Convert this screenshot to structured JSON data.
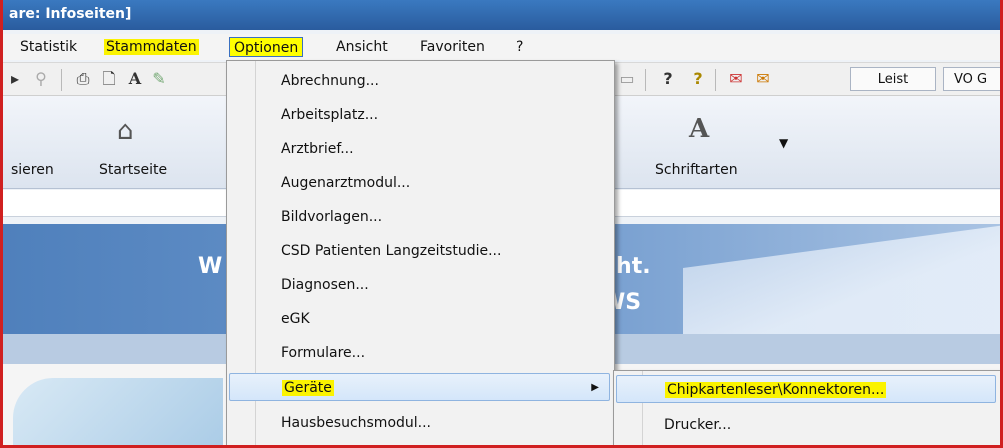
{
  "window": {
    "title": "are: Infoseiten]"
  },
  "menubar": {
    "items": [
      "Statistik",
      "Stammdaten",
      "Optionen",
      "Ansicht",
      "Favoriten",
      "?"
    ],
    "open_menu": "Optionen"
  },
  "toolbar": {
    "buttons": [
      "Leist",
      "VO G"
    ]
  },
  "ribbon": {
    "items": [
      "sieren",
      "Startseite",
      "Schriftarten"
    ]
  },
  "banner": {
    "fragments": [
      "W",
      "cht.",
      "WS"
    ]
  },
  "optionen_menu": {
    "items": [
      "Abrechnung...",
      "Arbeitsplatz...",
      "Arztbrief...",
      "Augenarztmodul...",
      "Bildvorlagen...",
      "CSD Patienten Langzeitstudie...",
      "Diagnosen...",
      "eGK",
      "Formulare...",
      "Geräte",
      "Hausbesuchsmodul..."
    ],
    "active_item": "Geräte"
  },
  "geraete_submenu": {
    "items": [
      "Chipkartenleser\\Konnektoren...",
      "Drucker..."
    ],
    "active_item": "Chipkartenleser\\Konnektoren..."
  },
  "colors": {
    "highlight": "#fbf300",
    "title_bar": "#2a5c9e",
    "frame": "#d02020"
  }
}
